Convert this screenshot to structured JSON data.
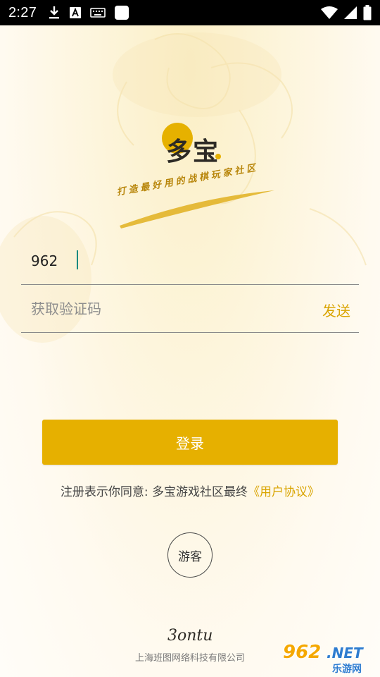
{
  "status_bar": {
    "time": "2:27",
    "left_icons": [
      "download-icon",
      "text-a-icon",
      "keyboard-icon",
      "app-square-icon"
    ],
    "right_icons": [
      "wifi-icon",
      "signal-icon",
      "battery-icon"
    ]
  },
  "brand": {
    "logo_text": "多宝",
    "slogan": "打造最好用的战棋玩家社区"
  },
  "form": {
    "phone_value": "962",
    "code_placeholder": "获取验证码",
    "send_label": "发送"
  },
  "login": {
    "button_label": "登录"
  },
  "agreement": {
    "prefix": "注册表示你同意: 多宝游戏社区最终",
    "link": "《用户协议》"
  },
  "guest": {
    "label": "游客"
  },
  "footer": {
    "company_logo_text": "3ontu",
    "company": "上海班图网络科技有限公司"
  },
  "watermark": {
    "number": "962",
    "net": ".NET",
    "site": "乐游网"
  },
  "colors": {
    "accent": "#e6b000",
    "link": "#d9a400",
    "statusbar": "#000000"
  }
}
